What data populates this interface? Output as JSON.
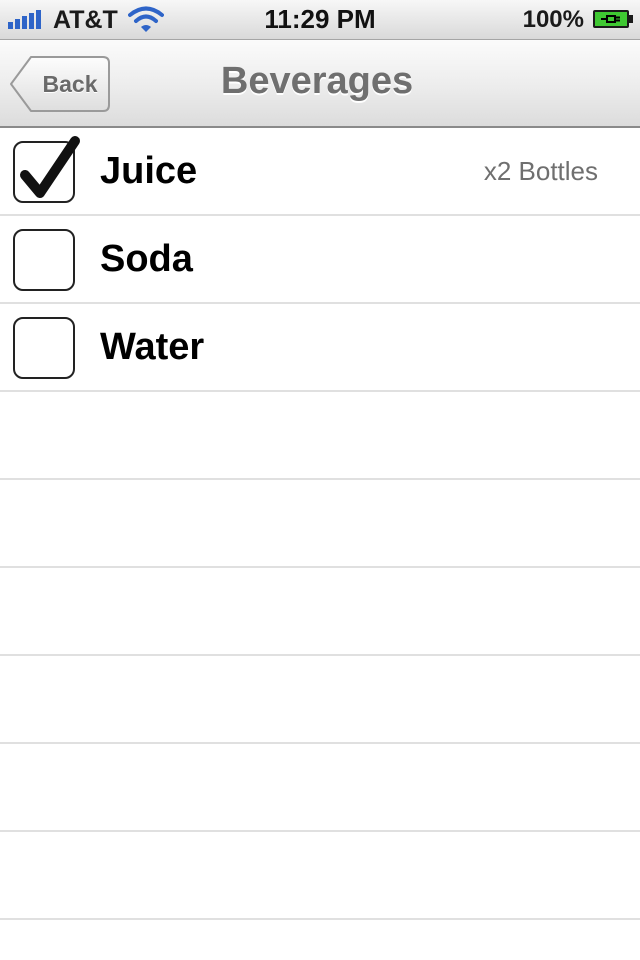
{
  "status_bar": {
    "carrier": "AT&T",
    "time": "11:29 PM",
    "battery": "100%",
    "battery_charging": true,
    "icons": [
      "signal-icon",
      "wifi-icon",
      "battery-icon"
    ]
  },
  "nav": {
    "back_label": "Back",
    "title": "Beverages"
  },
  "items": [
    {
      "label": "Juice",
      "checked": true,
      "detail": "x2 Bottles"
    },
    {
      "label": "Soda",
      "checked": false,
      "detail": ""
    },
    {
      "label": "Water",
      "checked": false,
      "detail": ""
    }
  ],
  "colors": {
    "title_text": "#6f6f6f",
    "detail_text": "#6f6f6f",
    "battery_fill": "#3fc832",
    "separator": "#e0e0e0"
  }
}
